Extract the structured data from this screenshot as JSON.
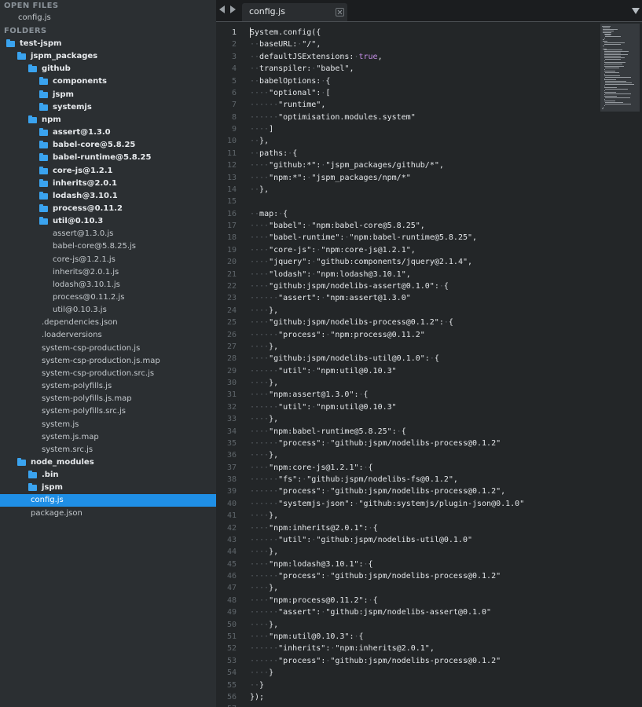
{
  "sidebar": {
    "open_files_header": "OPEN FILES",
    "open_files": [
      "config.js"
    ],
    "folders_header": "FOLDERS",
    "tree": [
      {
        "label": "test-jspm",
        "type": "folder",
        "depth": 0
      },
      {
        "label": "jspm_packages",
        "type": "folder",
        "depth": 1
      },
      {
        "label": "github",
        "type": "folder",
        "depth": 2
      },
      {
        "label": "components",
        "type": "folder",
        "depth": 3
      },
      {
        "label": "jspm",
        "type": "folder",
        "depth": 3
      },
      {
        "label": "systemjs",
        "type": "folder",
        "depth": 3
      },
      {
        "label": "npm",
        "type": "folder",
        "depth": 2
      },
      {
        "label": "assert@1.3.0",
        "type": "folder",
        "depth": 3
      },
      {
        "label": "babel-core@5.8.25",
        "type": "folder",
        "depth": 3
      },
      {
        "label": "babel-runtime@5.8.25",
        "type": "folder",
        "depth": 3
      },
      {
        "label": "core-js@1.2.1",
        "type": "folder",
        "depth": 3
      },
      {
        "label": "inherits@2.0.1",
        "type": "folder",
        "depth": 3
      },
      {
        "label": "lodash@3.10.1",
        "type": "folder",
        "depth": 3
      },
      {
        "label": "process@0.11.2",
        "type": "folder",
        "depth": 3
      },
      {
        "label": "util@0.10.3",
        "type": "folder",
        "depth": 3
      },
      {
        "label": "assert@1.3.0.js",
        "type": "file",
        "depth": 4
      },
      {
        "label": "babel-core@5.8.25.js",
        "type": "file",
        "depth": 4
      },
      {
        "label": "core-js@1.2.1.js",
        "type": "file",
        "depth": 4
      },
      {
        "label": "inherits@2.0.1.js",
        "type": "file",
        "depth": 4
      },
      {
        "label": "lodash@3.10.1.js",
        "type": "file",
        "depth": 4
      },
      {
        "label": "process@0.11.2.js",
        "type": "file",
        "depth": 4
      },
      {
        "label": "util@0.10.3.js",
        "type": "file",
        "depth": 4
      },
      {
        "label": ".dependencies.json",
        "type": "file",
        "depth": 3
      },
      {
        "label": ".loaderversions",
        "type": "file",
        "depth": 3
      },
      {
        "label": "system-csp-production.js",
        "type": "file",
        "depth": 3
      },
      {
        "label": "system-csp-production.js.map",
        "type": "file",
        "depth": 3
      },
      {
        "label": "system-csp-production.src.js",
        "type": "file",
        "depth": 3
      },
      {
        "label": "system-polyfills.js",
        "type": "file",
        "depth": 3
      },
      {
        "label": "system-polyfills.js.map",
        "type": "file",
        "depth": 3
      },
      {
        "label": "system-polyfills.src.js",
        "type": "file",
        "depth": 3
      },
      {
        "label": "system.js",
        "type": "file",
        "depth": 3
      },
      {
        "label": "system.js.map",
        "type": "file",
        "depth": 3
      },
      {
        "label": "system.src.js",
        "type": "file",
        "depth": 3
      },
      {
        "label": "node_modules",
        "type": "folder",
        "depth": 1
      },
      {
        "label": ".bin",
        "type": "folder",
        "depth": 2
      },
      {
        "label": "jspm",
        "type": "folder",
        "depth": 2
      },
      {
        "label": "config.js",
        "type": "file",
        "depth": 2,
        "selected": true
      },
      {
        "label": "package.json",
        "type": "file",
        "depth": 2
      }
    ]
  },
  "tabs": [
    {
      "label": "config.js",
      "active": true
    }
  ],
  "editor": {
    "current_line": 1,
    "lines": [
      "System.config({",
      "··baseURL:·\"/\",",
      "··defaultJSExtensions:·true,",
      "··transpiler:·\"babel\",",
      "··babelOptions:·{",
      "····\"optional\":·[",
      "······\"runtime\",",
      "······\"optimisation.modules.system\"",
      "····]",
      "··},",
      "··paths:·{",
      "····\"github:*\":·\"jspm_packages/github/*\",",
      "····\"npm:*\":·\"jspm_packages/npm/*\"",
      "··},",
      "",
      "··map:·{",
      "····\"babel\":·\"npm:babel-core@5.8.25\",",
      "····\"babel-runtime\":·\"npm:babel-runtime@5.8.25\",",
      "····\"core-js\":·\"npm:core-js@1.2.1\",",
      "····\"jquery\":·\"github:components/jquery@2.1.4\",",
      "····\"lodash\":·\"npm:lodash@3.10.1\",",
      "····\"github:jspm/nodelibs-assert@0.1.0\":·{",
      "······\"assert\":·\"npm:assert@1.3.0\"",
      "····},",
      "····\"github:jspm/nodelibs-process@0.1.2\":·{",
      "······\"process\":·\"npm:process@0.11.2\"",
      "····},",
      "····\"github:jspm/nodelibs-util@0.1.0\":·{",
      "······\"util\":·\"npm:util@0.10.3\"",
      "····},",
      "····\"npm:assert@1.3.0\":·{",
      "······\"util\":·\"npm:util@0.10.3\"",
      "····},",
      "····\"npm:babel-runtime@5.8.25\":·{",
      "······\"process\":·\"github:jspm/nodelibs-process@0.1.2\"",
      "····},",
      "····\"npm:core-js@1.2.1\":·{",
      "······\"fs\":·\"github:jspm/nodelibs-fs@0.1.2\",",
      "······\"process\":·\"github:jspm/nodelibs-process@0.1.2\",",
      "······\"systemjs-json\":·\"github:systemjs/plugin-json@0.1.0\"",
      "····},",
      "····\"npm:inherits@2.0.1\":·{",
      "······\"util\":·\"github:jspm/nodelibs-util@0.1.0\"",
      "····},",
      "····\"npm:lodash@3.10.1\":·{",
      "······\"process\":·\"github:jspm/nodelibs-process@0.1.2\"",
      "····},",
      "····\"npm:process@0.11.2\":·{",
      "······\"assert\":·\"github:jspm/nodelibs-assert@0.1.0\"",
      "····},",
      "····\"npm:util@0.10.3\":·{",
      "······\"inherits\":·\"npm:inherits@2.0.1\",",
      "······\"process\":·\"github:jspm/nodelibs-process@0.1.2\"",
      "····}",
      "··}",
      "});",
      ""
    ]
  },
  "colors": {
    "sidebar_bg": "#2b2f32",
    "editor_bg": "#232628",
    "selection": "#1f8fe6",
    "folder_icon": "#3aa3ef",
    "keyword_true": "#c48ee6"
  },
  "icons": [
    "folder-icon",
    "nav-left-arrow-icon",
    "nav-right-arrow-icon",
    "close-icon",
    "chevron-down-icon"
  ]
}
